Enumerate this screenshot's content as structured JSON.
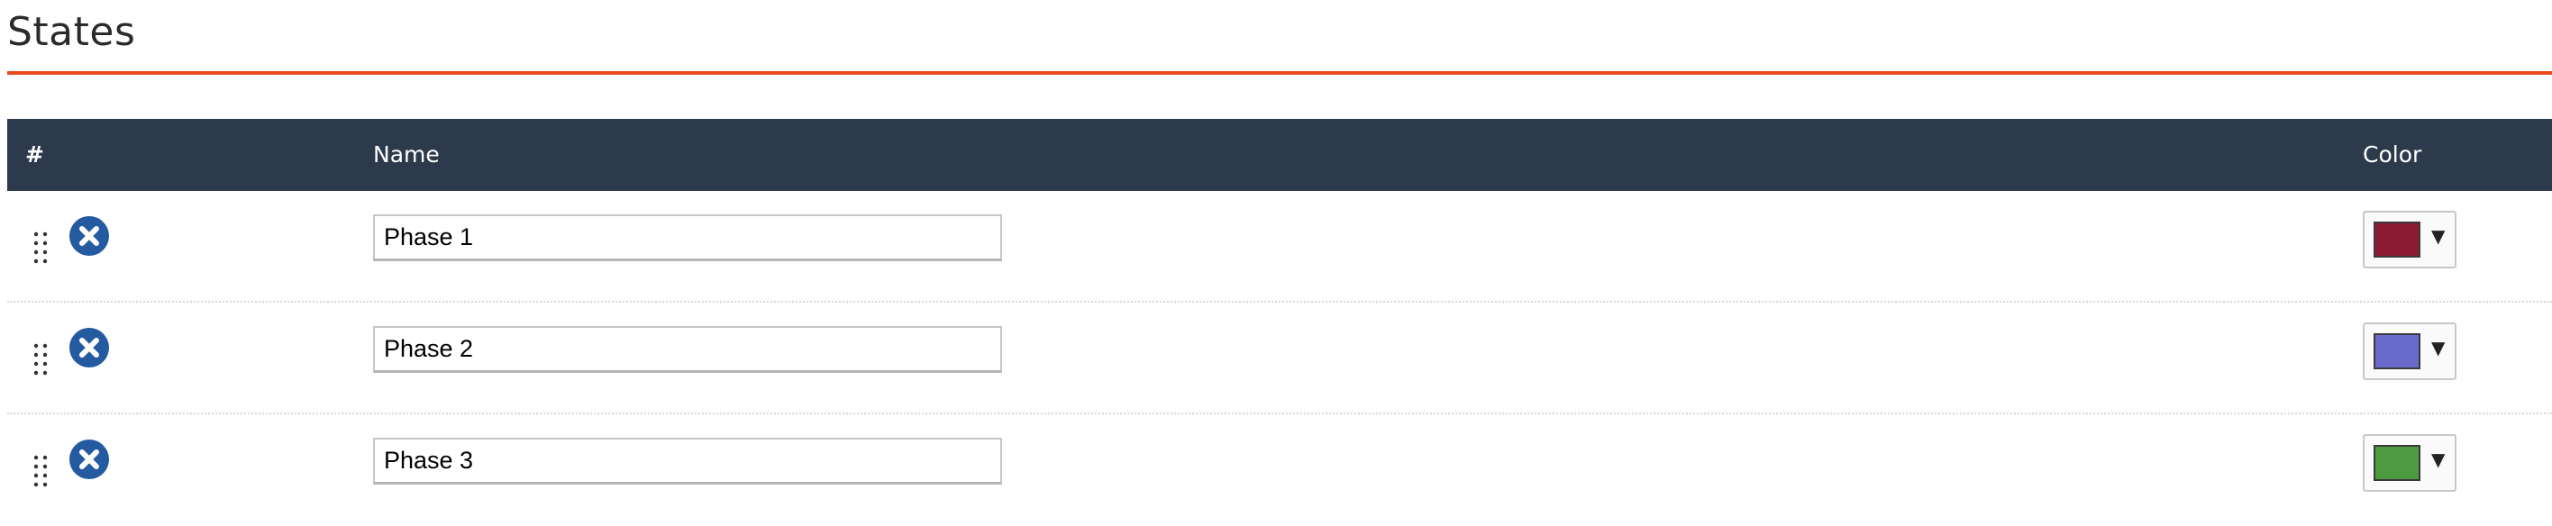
{
  "section": {
    "title": "States",
    "accent_color": "#e8491d"
  },
  "table": {
    "header_bg": "#2c3a4b",
    "columns": {
      "number": "#",
      "name": "Name",
      "color": "Color"
    },
    "rows": [
      {
        "name": "Phase 1",
        "color": "#8c1a33",
        "drag_icon": "drag-handle-icon",
        "remove_icon": "remove-circle-x-icon"
      },
      {
        "name": "Phase 2",
        "color": "#6a6acd",
        "drag_icon": "drag-handle-icon",
        "remove_icon": "remove-circle-x-icon"
      },
      {
        "name": "Phase 3",
        "color": "#4e9a40",
        "drag_icon": "drag-handle-icon",
        "remove_icon": "remove-circle-x-icon"
      }
    ],
    "caret_glyph": "▼",
    "remove_button_color": "#245aa0"
  }
}
